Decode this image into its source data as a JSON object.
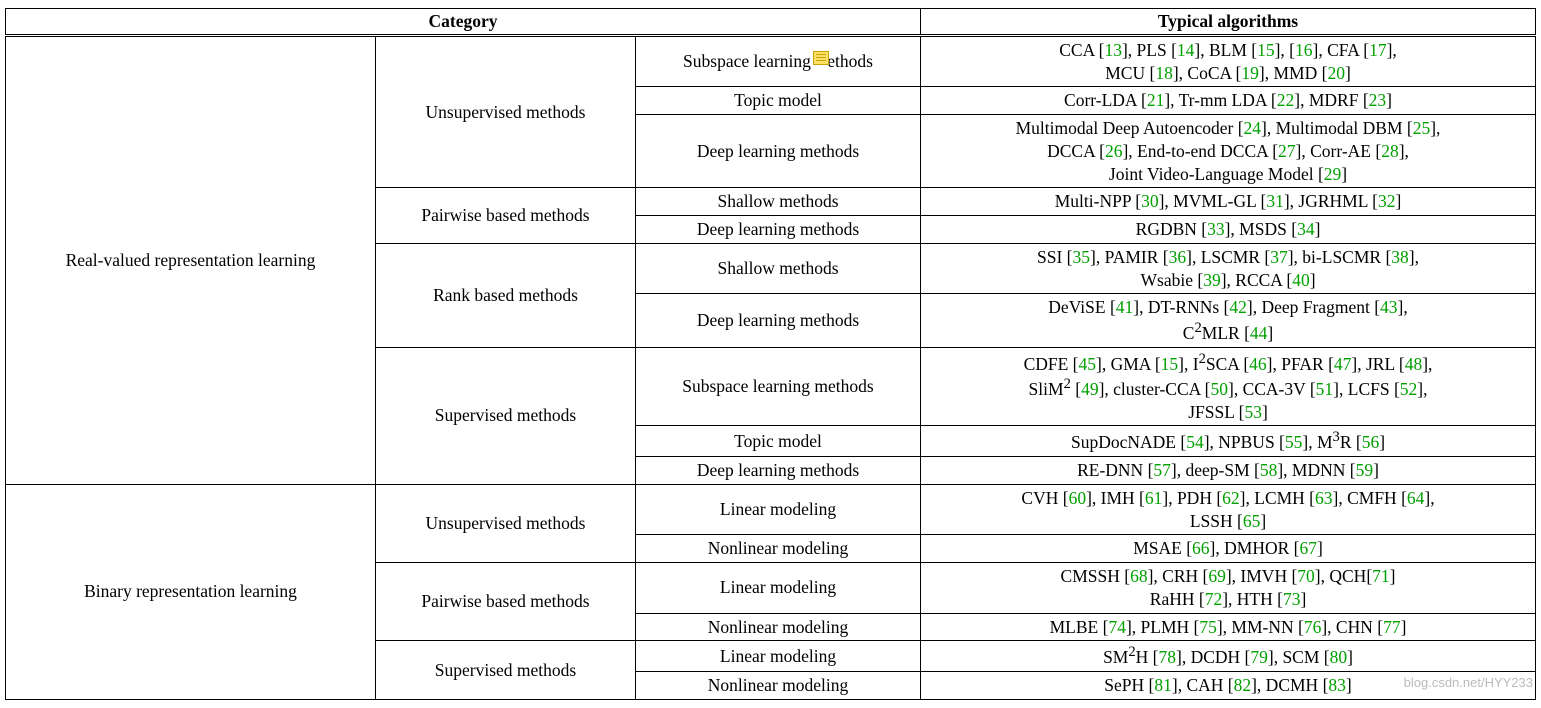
{
  "header": {
    "category": "Category",
    "algorithms": "Typical algorithms"
  },
  "col1": {
    "real": "Real-valued representation learning",
    "binary": "Binary representation learning"
  },
  "col2": {
    "unsup": "Unsupervised methods",
    "pair": "Pairwise based methods",
    "rank": "Rank based methods",
    "sup": "Supervised methods"
  },
  "col3": {
    "subspace": "Subspace learning",
    "subspace_full": "Subspace learning methods",
    "methods_tail": "ethods",
    "topic": "Topic model",
    "deep": "Deep learning methods",
    "shallow": "Shallow methods",
    "linear": "Linear modeling",
    "nonlinear": "Nonlinear modeling"
  },
  "rows": {
    "r1": [
      {
        "t": "CCA ",
        "r": "13"
      },
      {
        "t": ", PLS ",
        "r": "14"
      },
      {
        "t": ", BLM ",
        "r": "15"
      },
      {
        "t": ", ",
        "r": "16"
      },
      {
        "t": ", CFA ",
        "r": "17"
      },
      {
        "t": ",",
        "br": true
      },
      {
        "t": "MCU ",
        "r": "18"
      },
      {
        "t": ", CoCA ",
        "r": "19"
      },
      {
        "t": ", MMD ",
        "r": "20"
      }
    ],
    "r2": [
      {
        "t": "Corr-LDA ",
        "r": "21"
      },
      {
        "t": ", Tr-mm LDA ",
        "r": "22"
      },
      {
        "t": ", MDRF ",
        "r": "23"
      }
    ],
    "r3": [
      {
        "t": "Multimodal Deep Autoencoder ",
        "r": "24"
      },
      {
        "t": ", Multimodal DBM ",
        "r": "25"
      },
      {
        "t": ",",
        "br": true
      },
      {
        "t": "DCCA ",
        "r": "26"
      },
      {
        "t": ", End-to-end DCCA ",
        "r": "27"
      },
      {
        "t": ", Corr-AE ",
        "r": "28"
      },
      {
        "t": ",",
        "br": true
      },
      {
        "t": "Joint Video-Language Model ",
        "r": "29"
      }
    ],
    "r4": [
      {
        "t": "Multi-NPP ",
        "r": "30"
      },
      {
        "t": ", MVML-GL ",
        "r": "31"
      },
      {
        "t": ", JGRHML ",
        "r": "32"
      }
    ],
    "r5": [
      {
        "t": "RGDBN ",
        "r": "33"
      },
      {
        "t": ", MSDS ",
        "r": "34"
      }
    ],
    "r6": [
      {
        "t": "SSI ",
        "r": "35"
      },
      {
        "t": ", PAMIR ",
        "r": "36"
      },
      {
        "t": ", LSCMR ",
        "r": "37"
      },
      {
        "t": ", bi-LSCMR ",
        "r": "38"
      },
      {
        "t": ",",
        "br": true
      },
      {
        "t": "Wsabie ",
        "r": "39"
      },
      {
        "t": ", RCCA ",
        "r": "40"
      }
    ],
    "r7": [
      {
        "t": "DeViSE ",
        "r": "41"
      },
      {
        "t": ", DT-RNNs ",
        "r": "42"
      },
      {
        "t": ", Deep Fragment ",
        "r": "43"
      },
      {
        "t": ",",
        "br": true
      },
      {
        "t": "C",
        "sup": "2"
      },
      {
        "t": "MLR ",
        "r": "44"
      }
    ],
    "r8": [
      {
        "t": "CDFE ",
        "r": "45"
      },
      {
        "t": ", GMA ",
        "r": "15"
      },
      {
        "t": ", I",
        "sup": "2"
      },
      {
        "t": "SCA ",
        "r": "46"
      },
      {
        "t": ", PFAR ",
        "r": "47"
      },
      {
        "t": ", JRL ",
        "r": "48"
      },
      {
        "t": ",",
        "br": true
      },
      {
        "t": "SliM",
        "sup": "2"
      },
      {
        "t": " ",
        "r": "49"
      },
      {
        "t": ", cluster-CCA ",
        "r": "50"
      },
      {
        "t": ", CCA-3V ",
        "r": "51"
      },
      {
        "t": ", LCFS ",
        "r": "52"
      },
      {
        "t": ",",
        "br": true
      },
      {
        "t": "JFSSL ",
        "r": "53"
      }
    ],
    "r9": [
      {
        "t": "SupDocNADE ",
        "r": "54"
      },
      {
        "t": ", NPBUS ",
        "r": "55"
      },
      {
        "t": ", M",
        "sup": "3"
      },
      {
        "t": "R ",
        "r": "56"
      }
    ],
    "r10": [
      {
        "t": "RE-DNN ",
        "r": "57"
      },
      {
        "t": ", deep-SM ",
        "r": "58"
      },
      {
        "t": ", MDNN ",
        "r": "59"
      }
    ],
    "r11": [
      {
        "t": "CVH ",
        "r": "60"
      },
      {
        "t": ", IMH ",
        "r": "61"
      },
      {
        "t": ", PDH ",
        "r": "62"
      },
      {
        "t": ", LCMH ",
        "r": "63"
      },
      {
        "t": ", CMFH ",
        "r": "64"
      },
      {
        "t": ",",
        "br": true
      },
      {
        "t": "LSSH ",
        "r": "65"
      }
    ],
    "r12": [
      {
        "t": "MSAE ",
        "r": "66"
      },
      {
        "t": ", DMHOR ",
        "r": "67"
      }
    ],
    "r13": [
      {
        "t": "CMSSH ",
        "r": "68"
      },
      {
        "t": ", CRH ",
        "r": "69"
      },
      {
        "t": ", IMVH ",
        "r": "70"
      },
      {
        "t": ", QCH",
        "r": "71"
      },
      {
        "br": true
      },
      {
        "t": "RaHH ",
        "r": "72"
      },
      {
        "t": ", HTH ",
        "r": "73"
      }
    ],
    "r14": [
      {
        "t": "MLBE ",
        "r": "74"
      },
      {
        "t": ", PLMH ",
        "r": "75"
      },
      {
        "t": ", MM-NN ",
        "r": "76"
      },
      {
        "t": ", CHN ",
        "r": "77"
      }
    ],
    "r15": [
      {
        "t": "SM",
        "sup": "2"
      },
      {
        "t": "H ",
        "r": "78"
      },
      {
        "t": ", DCDH ",
        "r": "79"
      },
      {
        "t": ", SCM ",
        "r": "80"
      }
    ],
    "r16": [
      {
        "t": "SePH ",
        "r": "81"
      },
      {
        "t": ", CAH ",
        "r": "82"
      },
      {
        "t": ", DCMH ",
        "r": "83"
      }
    ]
  },
  "watermark": "blog.csdn.net/HYY233"
}
